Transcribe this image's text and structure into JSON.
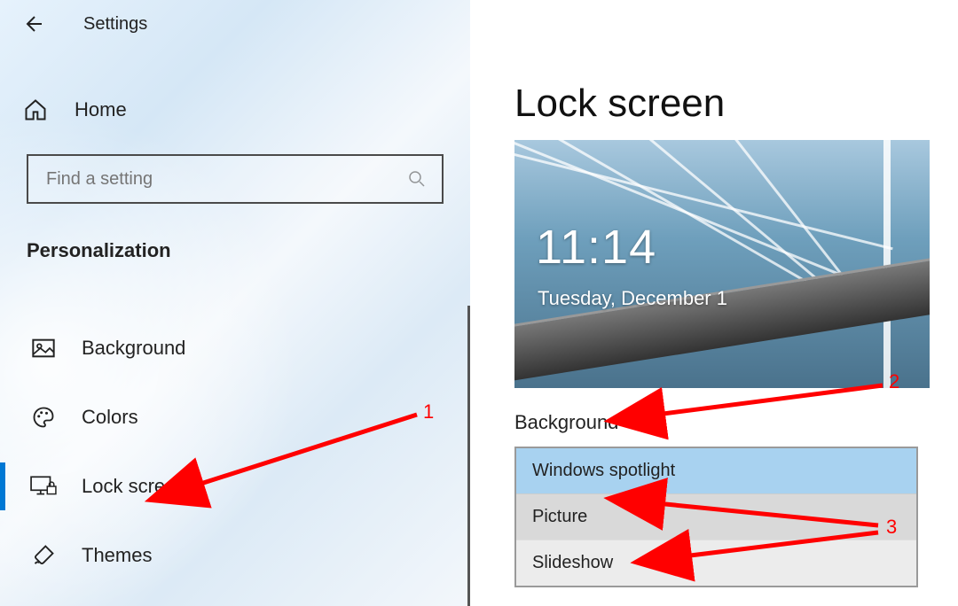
{
  "header": {
    "app_title": "Settings"
  },
  "sidebar": {
    "home_label": "Home",
    "search_placeholder": "Find a setting",
    "section": "Personalization",
    "items": [
      {
        "icon": "image-icon",
        "label": "Background",
        "selected": false
      },
      {
        "icon": "palette-icon",
        "label": "Colors",
        "selected": false
      },
      {
        "icon": "monitor-lock-icon",
        "label": "Lock screen",
        "selected": true
      },
      {
        "icon": "brush-icon",
        "label": "Themes",
        "selected": false
      }
    ]
  },
  "content": {
    "title": "Lock screen",
    "preview": {
      "time": "11:14",
      "date": "Tuesday, December 1"
    },
    "background_field": {
      "label": "Background",
      "options": [
        {
          "label": "Windows spotlight",
          "selected": true
        },
        {
          "label": "Picture",
          "selected": false
        },
        {
          "label": "Slideshow",
          "selected": false
        }
      ]
    }
  },
  "annotations": [
    {
      "num": "1"
    },
    {
      "num": "2"
    },
    {
      "num": "3"
    }
  ]
}
